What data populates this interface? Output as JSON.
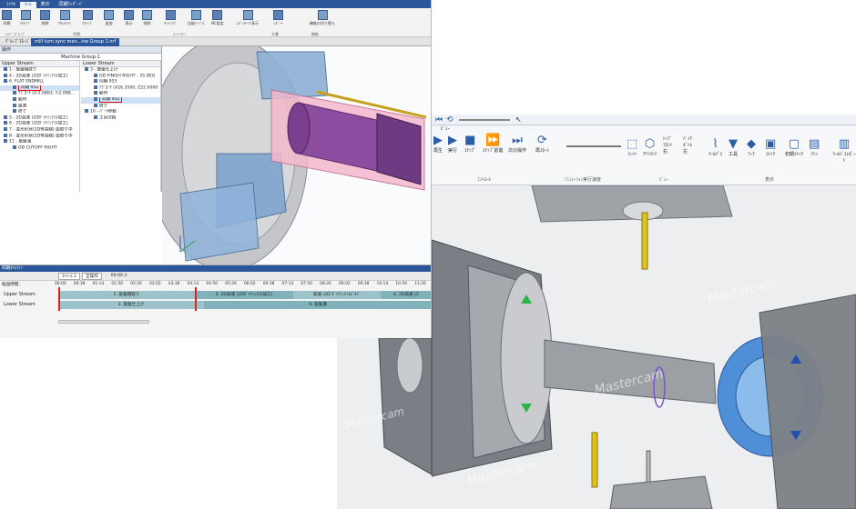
{
  "left_window": {
    "menu_tabs": [
      "ﾌｧｲﾙ",
      "ﾎｰﾑ",
      "表示",
      "同期ｳｨｻﾞｰﾄﾞ"
    ],
    "ribbon": {
      "buttons": [
        {
          "label": "同期"
        },
        {
          "label": "ｱｸﾃｨﾌﾞ"
        },
        {
          "label": "削除"
        },
        {
          "label": "ｱﾀｯﾁﾒﾝﾄ"
        },
        {
          "label": "ｱｸﾃｨﾌﾞ"
        },
        {
          "label": "追加"
        },
        {
          "label": "表示"
        },
        {
          "label": "削除"
        },
        {
          "label": "ｵｰﾃｨﾝｸﾞ"
        },
        {
          "label": "比較ﾃｰﾌﾞﾙ"
        },
        {
          "label": "NC設定"
        },
        {
          "label": "ｴﾃﾞｨﾀｰで表示"
        },
        {
          "label": "ﾚﾎﾟｰﾄ"
        },
        {
          "label": "機能の切り替え"
        }
      ],
      "groups": [
        "ｼｬﾄﾞｰｸﾞﾙｰﾌﾟ",
        "同期",
        "ﾕｰﾃｨﾘﾃｨ",
        "文書",
        "機能"
      ]
    },
    "doc_tabs": [
      "ｸﾞﾙｰﾌﾟﾏﾈｰｼﾞｬ",
      "mill turn sync man...ine Group 1.nrf"
    ],
    "panel": {
      "header": "操作",
      "machine_group": "Machine Group-1",
      "upper": {
        "title": "Upper Stream",
        "rows": [
          {
            "text": "1 - 旋盤粗取り",
            "sel": false,
            "hl": false
          },
          {
            "text": "4 - 2D高速 (2Dﾀﾞｲﾅﾐｯｸﾐﾙ加工)",
            "sel": false,
            "hl": false
          },
          {
            "text": "6. FLAT ENDMILL",
            "sel": false,
            "hl": false
          },
          {
            "text": "同期 952",
            "sel": true,
            "hl": true
          },
          {
            "text": "ｱﾌﾟﾛｰﾁ (X-2.0883, Y-2.088...",
            "sel": false,
            "hl": false
          },
          {
            "text": "動作",
            "sel": false,
            "hl": false
          },
          {
            "text": "最適",
            "sel": false,
            "hl": false
          },
          {
            "text": "終了",
            "sel": false,
            "hl": false
          },
          {
            "text": "5 - 2D高速 (2Dﾀﾞｲﾅﾐｯｸﾐﾙ加工)",
            "sel": false,
            "hl": false
          },
          {
            "text": "6 - 2D高速 (2Dﾀﾞｲﾅﾐｯｸﾐﾙ加工)",
            "sel": false,
            "hl": false
          },
          {
            "text": "7 - 変形形状(2D等高線) 面取り中",
            "sel": false,
            "hl": false
          },
          {
            "text": "8 - 変形形状(2D等高線) 面取り中",
            "sel": false,
            "hl": false
          },
          {
            "text": "11 - 旋盤溝",
            "sel": false,
            "hl": false
          },
          {
            "text": "OD CUTOFF RIGHT",
            "sel": false,
            "hl": false
          }
        ]
      },
      "lower": {
        "title": "Lower Stream",
        "rows": [
          {
            "text": "3 - 旋盤仕上げ",
            "sel": false,
            "hl": false
          },
          {
            "text": "OD FINISH RIGHT - 35 DEG",
            "sel": false,
            "hl": false
          },
          {
            "text": "同期 953",
            "sel": false,
            "hl": false
          },
          {
            "text": "ｱﾌﾟﾛｰﾁ (X26.3500, Z22.0000",
            "sel": false,
            "hl": false
          },
          {
            "text": "動作",
            "sel": false,
            "hl": false
          },
          {
            "text": "同期 952",
            "sel": true,
            "hl": true
          },
          {
            "text": "終了",
            "sel": false,
            "hl": false
          },
          {
            "text": "10 - ﾊﾟｰﾄ移動",
            "sel": false,
            "hl": false
          },
          {
            "text": "工具交換",
            "sel": false,
            "hl": false
          }
        ]
      }
    },
    "timeline": {
      "title": "同期ﾀｲﾑﾗｲﾝ",
      "tab1": "ｽﾄﾘｰﾑ 1",
      "tab2": "全操作",
      "time": "00:00.3",
      "label": "経過時間:",
      "ticks": [
        "00:00",
        "00:38",
        "01:14",
        "01:50",
        "02:26",
        "03:02",
        "03:38",
        "04:14",
        "04:50",
        "05:26",
        "06:02",
        "06:38",
        "07:14",
        "07:50",
        "08:26",
        "09:02",
        "09:38",
        "10:14",
        "10:50",
        "11:26"
      ],
      "upper_label": "Upper Stream",
      "lower_label": "Lower Stream",
      "upper_segments": [
        "2. 旋盤粗取り",
        "4. 2D高速 (2Dﾀﾞｲﾅﾐｯｸﾐﾙ加工)",
        "高速 (2D ﾀﾞｲﾅﾐｯｸﾐﾙﾋﾞﾙﾄﾞ",
        "6. 2D高速 (2"
      ],
      "lower_segments": [
        "3. 旋盤仕上げ",
        "9. 旋盤溝"
      ]
    }
  },
  "right_window": {
    "sub_label": "ﾋﾞｭｰ",
    "controls": {
      "play": "再生",
      "run": "実行",
      "stop": "ｽﾃｯﾌﾟ",
      "step_back": "ｽﾃｯﾌﾟ前進",
      "step_fwd": "次の操作",
      "restart": "再ｽﾀｰﾄ",
      "group_label": "ｺﾝﾄﾛｰﾙ",
      "sim_speed": "ｼﾐｭﾚｰｼｮﾝ実行速度"
    },
    "view": {
      "fit": "ﾌｨｯﾄ",
      "iso": "ｱｲｿﾒﾄﾘ",
      "top": "ﾄｯﾌﾟ",
      "front": "ﾌﾛﾝﾄ",
      "right": "右",
      "back": "ﾊﾞｯｸ",
      "bottom": "ﾎﾞﾄﾑ",
      "left": "左",
      "group_label": "ﾋﾞｭｰ"
    },
    "display": {
      "toolpath": "ﾂｰﾙﾊﾟｽ",
      "tool": "工具",
      "work": "ﾜｰｸ",
      "stock": "ｽﾄｯｸ",
      "initial": "初期ｽﾄｯｸ",
      "machine": "ﾏｼﾝ",
      "machine_comp": "ﾏｼﾝｺﾝﾎﾟｰﾈﾝﾄ",
      "tool_report": "ﾂｰﾙﾊﾟｽﾚﾎﾟｰﾄ",
      "group_label": "表示"
    },
    "watermark": "Mastercam"
  }
}
